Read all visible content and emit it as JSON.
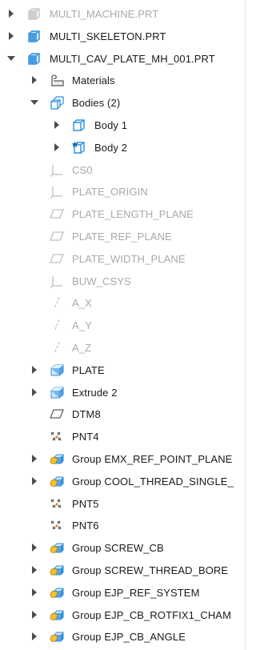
{
  "tree": [
    {
      "label": "MULTI_MACHINE.PRT",
      "icon": "part-icon",
      "toggle": "collapsed",
      "level": 0,
      "dim": true
    },
    {
      "label": "MULTI_SKELETON.PRT",
      "icon": "part-icon",
      "toggle": "collapsed",
      "level": 0,
      "dim": false
    },
    {
      "label": "MULTI_CAV_PLATE_MH_001.PRT",
      "icon": "part-icon",
      "toggle": "expanded",
      "level": 0,
      "dim": false
    },
    {
      "label": "Materials",
      "icon": "materials-icon",
      "toggle": "collapsed",
      "level": 1,
      "dim": false
    },
    {
      "label": "Bodies (2)",
      "icon": "bodies-icon",
      "toggle": "expanded",
      "level": 1,
      "dim": false
    },
    {
      "label": "Body 1",
      "icon": "body-icon",
      "toggle": "collapsed",
      "level": 2,
      "dim": false
    },
    {
      "label": "Body 2",
      "icon": "body-default-icon",
      "toggle": "collapsed",
      "level": 2,
      "dim": false
    },
    {
      "label": "CS0",
      "icon": "csys-icon",
      "toggle": "none",
      "level": 1,
      "dim": true
    },
    {
      "label": "PLATE_ORIGIN",
      "icon": "csys-icon",
      "toggle": "none",
      "level": 1,
      "dim": true
    },
    {
      "label": "PLATE_LENGTH_PLANE",
      "icon": "datum-plane-icon",
      "toggle": "none",
      "level": 1,
      "dim": true
    },
    {
      "label": "PLATE_REF_PLANE",
      "icon": "datum-plane-icon",
      "toggle": "none",
      "level": 1,
      "dim": true
    },
    {
      "label": "PLATE_WIDTH_PLANE",
      "icon": "datum-plane-icon",
      "toggle": "none",
      "level": 1,
      "dim": true
    },
    {
      "label": "BUW_CSYS",
      "icon": "csys-icon",
      "toggle": "none",
      "level": 1,
      "dim": true
    },
    {
      "label": "A_X",
      "icon": "datum-axis-icon",
      "toggle": "none",
      "level": 1,
      "dim": true
    },
    {
      "label": "A_Y",
      "icon": "datum-axis-icon",
      "toggle": "none",
      "level": 1,
      "dim": true
    },
    {
      "label": "A_Z",
      "icon": "datum-axis-icon",
      "toggle": "none",
      "level": 1,
      "dim": true
    },
    {
      "label": "PLATE",
      "icon": "extrude-icon",
      "toggle": "collapsed",
      "level": 1,
      "dim": false
    },
    {
      "label": "Extrude 2",
      "icon": "extrude-icon",
      "toggle": "collapsed",
      "level": 1,
      "dim": false
    },
    {
      "label": "DTM8",
      "icon": "datum-plane-icon",
      "toggle": "none",
      "level": 1,
      "dim": false
    },
    {
      "label": "PNT4",
      "icon": "datum-point-icon",
      "toggle": "none",
      "level": 1,
      "dim": false
    },
    {
      "label": "Group EMX_REF_POINT_PLANE",
      "icon": "group-icon",
      "toggle": "collapsed",
      "level": 1,
      "dim": false
    },
    {
      "label": "Group COOL_THREAD_SINGLE_",
      "icon": "group-icon",
      "toggle": "collapsed",
      "level": 1,
      "dim": false
    },
    {
      "label": "PNT5",
      "icon": "datum-point-icon",
      "toggle": "none",
      "level": 1,
      "dim": false
    },
    {
      "label": "PNT6",
      "icon": "datum-point-icon",
      "toggle": "none",
      "level": 1,
      "dim": false
    },
    {
      "label": "Group SCREW_CB",
      "icon": "group-icon",
      "toggle": "collapsed",
      "level": 1,
      "dim": false
    },
    {
      "label": "Group SCREW_THREAD_BORE",
      "icon": "group-icon",
      "toggle": "collapsed",
      "level": 1,
      "dim": false
    },
    {
      "label": "Group EJP_REF_SYSTEM",
      "icon": "group-icon",
      "toggle": "collapsed",
      "level": 1,
      "dim": false
    },
    {
      "label": "Group EJP_CB_ROTFIX1_CHAM",
      "icon": "group-icon",
      "toggle": "collapsed",
      "level": 1,
      "dim": false
    },
    {
      "label": "Group EJP_CB_ANGLE",
      "icon": "group-icon",
      "toggle": "collapsed",
      "level": 1,
      "dim": false
    },
    {
      "label": "",
      "icon": "group-icon",
      "toggle": "collapsed",
      "level": 1,
      "dim": false
    }
  ],
  "colors": {
    "icon_blue": "#2f8fdc",
    "icon_blue_light": "#cfe6f8",
    "dim_text": "#a9a9a9",
    "text": "#1a1a1a",
    "toggle": "#4d4d4d",
    "group_yellow": "#f2c230"
  }
}
